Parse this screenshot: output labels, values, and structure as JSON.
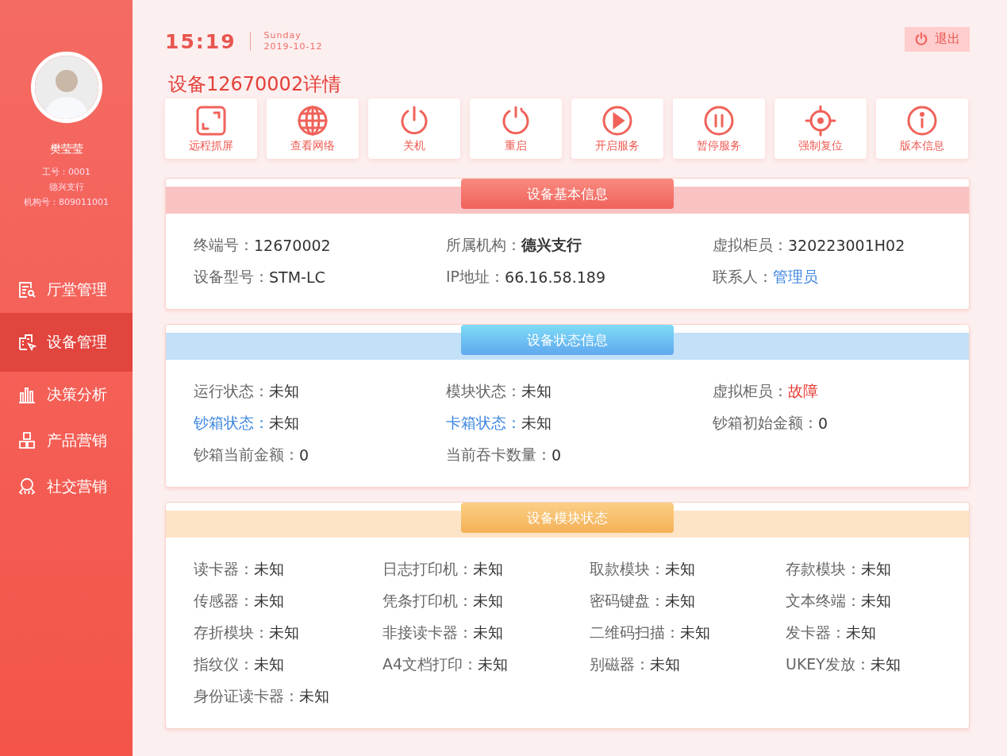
{
  "user": {
    "name": "樊莹莹",
    "lines": [
      "工号：0001",
      "德兴支行",
      "机构号：809011001"
    ]
  },
  "nav": [
    {
      "label": "厅堂管理",
      "selected": false
    },
    {
      "label": "设备管理",
      "selected": true
    },
    {
      "label": "决策分析",
      "selected": false
    },
    {
      "label": "产品营销",
      "selected": false
    },
    {
      "label": "社交营销",
      "selected": false
    }
  ],
  "clock": {
    "time": "15:19",
    "weekday": "Sunday",
    "date": "2019-10-12"
  },
  "logout": {
    "label": "退出"
  },
  "title": "设备12670002详情",
  "actions": [
    {
      "label": "远程抓屏"
    },
    {
      "label": "查看网络"
    },
    {
      "label": "关机"
    },
    {
      "label": "重启"
    },
    {
      "label": "开启服务"
    },
    {
      "label": "暂停服务"
    },
    {
      "label": "强制复位"
    },
    {
      "label": "版本信息"
    }
  ],
  "sections": [
    {
      "title": "设备基本信息",
      "kind": "basic",
      "fields": [
        {
          "label": "终端号：",
          "value": "12670002",
          "kind": "plain"
        },
        {
          "label": "所属机构：",
          "value": "德兴支行",
          "kind": "bold"
        },
        {
          "label": "虚拟柜员：",
          "value": "320223001H02",
          "kind": "plain"
        },
        {
          "label": "设备型号：",
          "value": "STM-LC",
          "kind": "plain"
        },
        {
          "label": "IP地址：",
          "value": "66.16.58.189",
          "kind": "plain"
        },
        {
          "label": "联系人：",
          "value": "管理员",
          "kind": "link"
        }
      ]
    },
    {
      "title": "设备状态信息",
      "kind": "status",
      "fields": [
        {
          "label": "运行状态：",
          "value": "未知",
          "kind": "plain"
        },
        {
          "label": "模块状态：",
          "value": "未知",
          "kind": "plain"
        },
        {
          "label": "虚拟柜员：",
          "value": "故障",
          "kind": "alert"
        },
        {
          "label": "钞箱状态：",
          "value": "未知",
          "kind": "highlight"
        },
        {
          "label": "卡箱状态：",
          "value": "未知",
          "kind": "highlight"
        },
        {
          "label": "钞箱初始金额：",
          "value": "0",
          "kind": "plain"
        },
        {
          "label": "钞箱当前金额：",
          "value": "0",
          "kind": "plain"
        },
        {
          "label": "当前吞卡数量：",
          "value": "0",
          "kind": "plain"
        }
      ]
    },
    {
      "title": "设备模块状态",
      "kind": "module",
      "fields": [
        {
          "label": "读卡器：",
          "value": "未知",
          "kind": "plain"
        },
        {
          "label": "日志打印机：",
          "value": "未知",
          "kind": "plain"
        },
        {
          "label": "取款模块：",
          "value": "未知",
          "kind": "plain"
        },
        {
          "label": "存款模块：",
          "value": "未知",
          "kind": "plain"
        },
        {
          "label": "传感器：",
          "value": "未知",
          "kind": "plain"
        },
        {
          "label": "凭条打印机：",
          "value": "未知",
          "kind": "plain"
        },
        {
          "label": "密码键盘：",
          "value": "未知",
          "kind": "plain"
        },
        {
          "label": "文本终端：",
          "value": "未知",
          "kind": "plain"
        },
        {
          "label": "存折模块：",
          "value": "未知",
          "kind": "plain"
        },
        {
          "label": "非接读卡器：",
          "value": "未知",
          "kind": "plain"
        },
        {
          "label": "二维码扫描：",
          "value": "未知",
          "kind": "plain"
        },
        {
          "label": "发卡器：",
          "value": "未知",
          "kind": "plain"
        },
        {
          "label": "指纹仪：",
          "value": "未知",
          "kind": "plain"
        },
        {
          "label": "A4文档打印：",
          "value": "未知",
          "kind": "plain"
        },
        {
          "label": "别磁器：",
          "value": "未知",
          "kind": "plain"
        },
        {
          "label": "UKEY发放：",
          "value": "未知",
          "kind": "plain"
        },
        {
          "label": "身份证读卡器：",
          "value": "未知",
          "kind": "plain"
        }
      ]
    }
  ]
}
